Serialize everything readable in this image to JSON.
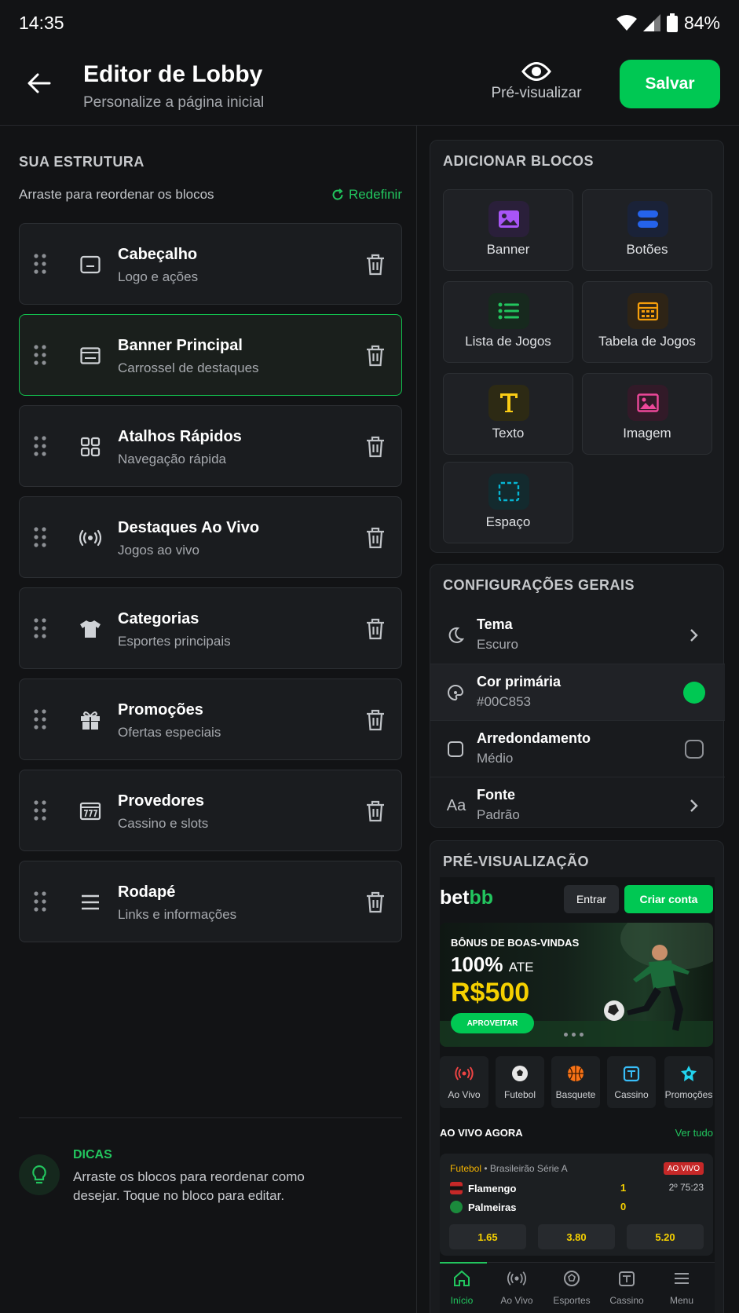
{
  "status": {
    "time": "14:35",
    "battery": "84%"
  },
  "header": {
    "title": "Editor de Lobby",
    "subtitle": "Personalize a página inicial",
    "preview_label": "Pré-visualizar",
    "save_label": "Salvar"
  },
  "structure": {
    "title": "SUA ESTRUTURA",
    "subtitle": "Arraste para reordenar os blocos",
    "reset_label": "Redefinir",
    "blocks": [
      {
        "name": "Cabeçalho",
        "desc": "Logo e ações",
        "icon": "header-icon"
      },
      {
        "name": "Banner Principal",
        "desc": "Carrossel de destaques",
        "icon": "banner-icon"
      },
      {
        "name": "Atalhos Rápidos",
        "desc": "Navegação rápida",
        "icon": "grid-icon"
      },
      {
        "name": "Destaques Ao Vivo",
        "desc": "Jogos ao vivo",
        "icon": "live-icon"
      },
      {
        "name": "Categorias",
        "desc": "Esportes principais",
        "icon": "shirt-icon"
      },
      {
        "name": "Promoções",
        "desc": "Ofertas especiais",
        "icon": "gift-icon"
      },
      {
        "name": "Provedores",
        "desc": "Cassino e slots",
        "icon": "slot-icon"
      },
      {
        "name": "Rodapé",
        "desc": "Links e informações",
        "icon": "menu-icon"
      }
    ]
  },
  "tips": {
    "title": "DICAS",
    "text": "Arraste os blocos para reordenar como desejar. Toque no bloco para editar."
  },
  "add_blocks": {
    "title": "ADICIONAR BLOCOS",
    "items": [
      {
        "label": "Banner",
        "icon": "image-icon",
        "color": "#a855f7"
      },
      {
        "label": "Botões",
        "icon": "buttons-icon",
        "color": "#2563eb"
      },
      {
        "label": "Lista de Jogos",
        "icon": "list-icon",
        "color": "#22c55e"
      },
      {
        "label": "Tabela de Jogos",
        "icon": "table-icon",
        "color": "#f59e0b"
      },
      {
        "label": "Texto",
        "icon": "text-icon",
        "color": "#facc15"
      },
      {
        "label": "Imagem",
        "icon": "picture-icon",
        "color": "#ec4899"
      },
      {
        "label": "Espaço",
        "icon": "space-icon",
        "color": "#06b6d4"
      }
    ]
  },
  "settings": {
    "title": "CONFIGURAÇÕES GERAIS",
    "items": [
      {
        "name": "Tema",
        "value": "Escuro"
      },
      {
        "name": "Cor primária",
        "value": "#00C853"
      },
      {
        "name": "Arredondamento",
        "value": "Médio"
      },
      {
        "name": "Fonte",
        "value": "Padrão",
        "icon_text": "Aa"
      }
    ]
  },
  "preview": {
    "title": "PRÉ-VISUALIZAÇÃO",
    "logo_a": "bet",
    "logo_b": "bb",
    "login_label": "Entrar",
    "signup_label": "Criar conta",
    "banner": {
      "line1": "BÔNUS DE BOAS-VINDAS",
      "pct": "100%",
      "ate": "ATE",
      "amount": "R$500",
      "cta": "APROVEITAR"
    },
    "shortcuts": [
      "Ao Vivo",
      "Futebol",
      "Basquete",
      "Cassino",
      "Promoções"
    ],
    "live_title": "AO VIVO AGORA",
    "see_all": "Ver tudo",
    "match": {
      "sport": "Futebol",
      "league": "• Brasileirão Série A",
      "badge": "AO VIVO",
      "home": "Flamengo",
      "away": "Palmeiras",
      "home_score": "1",
      "away_score": "0",
      "time": "2º 75:23",
      "odds": [
        "1.65",
        "3.80",
        "5.20"
      ]
    },
    "nav": [
      "Início",
      "Ao Vivo",
      "Esportes",
      "Cassino",
      "Menu"
    ]
  },
  "colors": {
    "accent": "#00C853",
    "live": "#C62828",
    "highlight": "#F5D000"
  }
}
